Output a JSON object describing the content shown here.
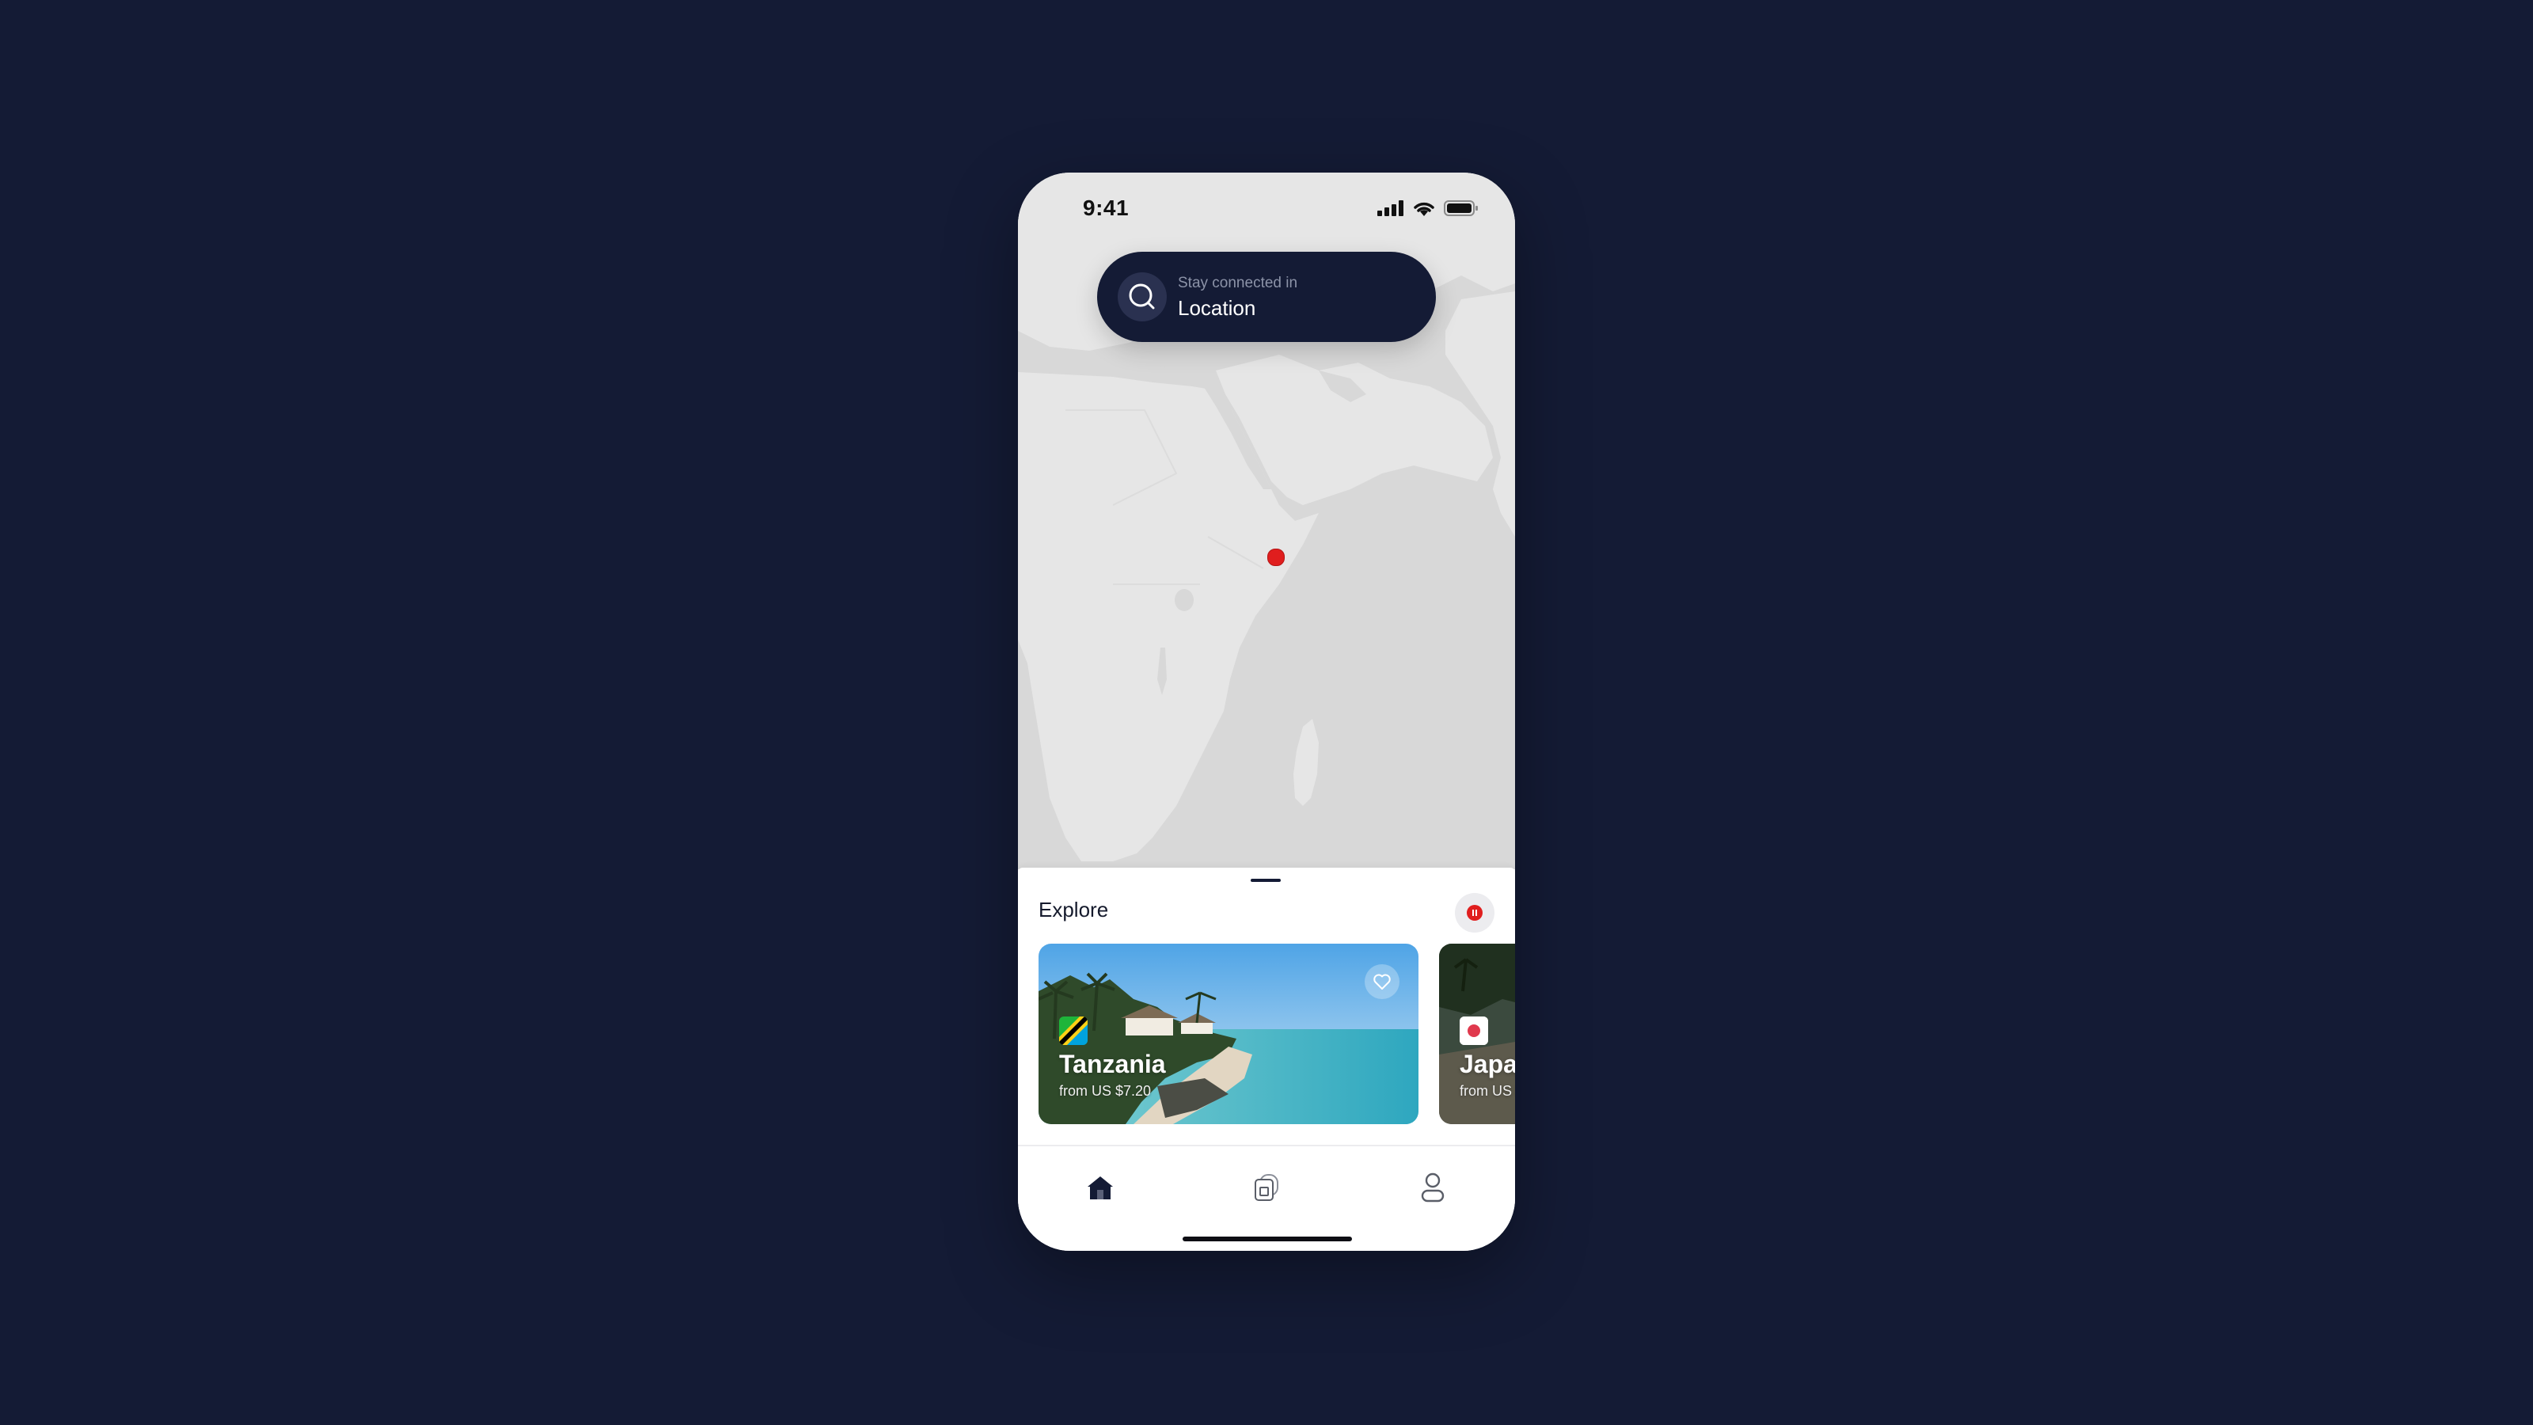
{
  "status_bar": {
    "time": "9:41"
  },
  "search": {
    "subtitle": "Stay connected in",
    "title": "Location",
    "icon": "search-icon"
  },
  "map": {
    "pin_color": "#e01e1e",
    "land_color": "#e6e6e6",
    "water_color": "#d8d8d8"
  },
  "explore": {
    "title": "Explore",
    "cards": [
      {
        "name": "Tanzania",
        "price": "from US $7.20",
        "flag": "tanzania-flag-icon",
        "favorite_icon": "heart-icon"
      },
      {
        "name": "Japan",
        "price": "from US $",
        "flag": "japan-flag-icon"
      }
    ]
  },
  "tabbar": {
    "items": [
      {
        "icon": "home-icon",
        "active": true
      },
      {
        "icon": "esim-cards-icon",
        "active": false
      },
      {
        "icon": "profile-icon",
        "active": false
      }
    ]
  },
  "colors": {
    "background": "#141b35",
    "accent": "#141b35",
    "pin": "#e01e1e"
  }
}
